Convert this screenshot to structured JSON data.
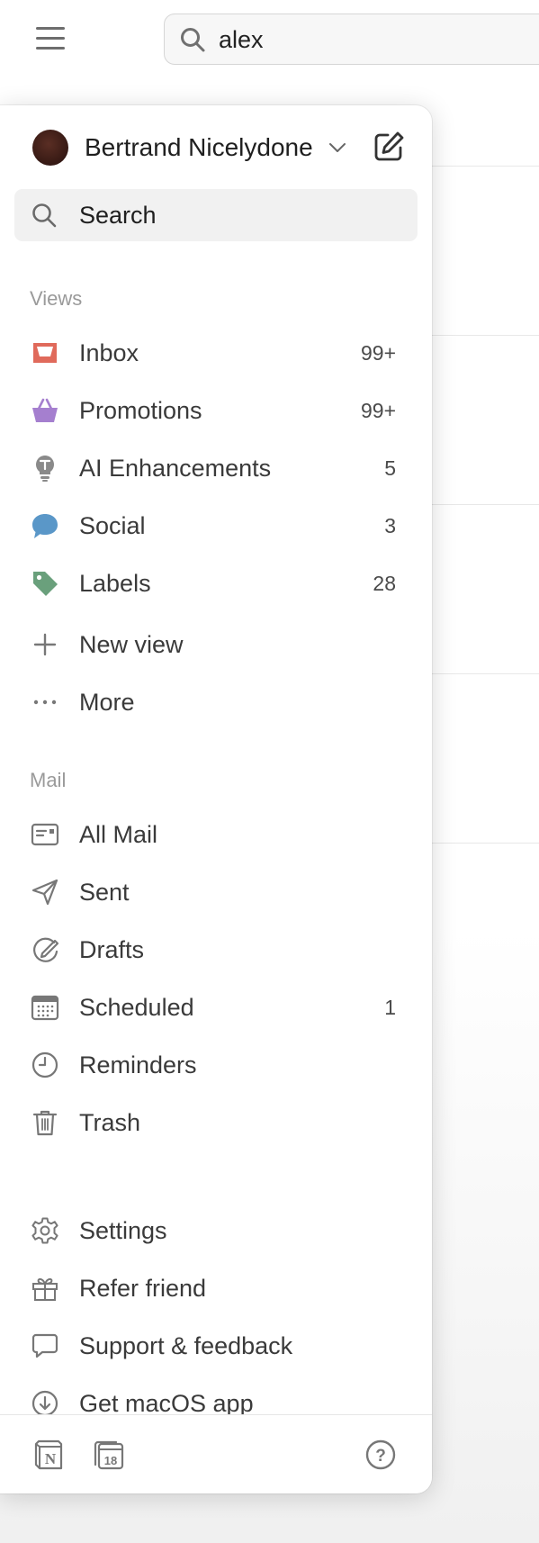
{
  "search": {
    "value": "alex"
  },
  "account": {
    "name": "Bertrand Nicelydone"
  },
  "panel_search": {
    "label": "Search"
  },
  "views": {
    "heading": "Views",
    "items": [
      {
        "label": "Inbox",
        "count": "99+",
        "icon": "inbox-icon",
        "color": "#e06a5b"
      },
      {
        "label": "Promotions",
        "count": "99+",
        "icon": "basket-icon",
        "color": "#a57fcf"
      },
      {
        "label": "AI Enhancements",
        "count": "5",
        "icon": "lightbulb-icon",
        "color": "#8a8a8a"
      },
      {
        "label": "Social",
        "count": "3",
        "icon": "chat-bubble-icon",
        "color": "#5a97c8"
      },
      {
        "label": "Labels",
        "count": "28",
        "icon": "tag-icon",
        "color": "#6aa07c"
      }
    ],
    "new_view": "New view",
    "more": "More"
  },
  "mail": {
    "heading": "Mail",
    "items": [
      {
        "label": "All Mail",
        "count": "",
        "icon": "all-mail-icon"
      },
      {
        "label": "Sent",
        "count": "",
        "icon": "paper-plane-icon"
      },
      {
        "label": "Drafts",
        "count": "",
        "icon": "draft-icon"
      },
      {
        "label": "Scheduled",
        "count": "1",
        "icon": "calendar-icon"
      },
      {
        "label": "Reminders",
        "count": "",
        "icon": "clock-icon"
      },
      {
        "label": "Trash",
        "count": "",
        "icon": "trash-icon"
      }
    ]
  },
  "bottom": {
    "items": [
      {
        "label": "Settings",
        "icon": "gear-icon"
      },
      {
        "label": "Refer friend",
        "icon": "gift-icon"
      },
      {
        "label": "Support & feedback",
        "icon": "speech-bubble-icon"
      },
      {
        "label": "Get macOS app",
        "icon": "download-icon"
      }
    ]
  },
  "footer": {
    "icons": [
      "notion-icon",
      "calendar-18-icon",
      "help-icon"
    ],
    "calendar_day": "18",
    "notion_letter": "N",
    "help_glyph": "?"
  }
}
